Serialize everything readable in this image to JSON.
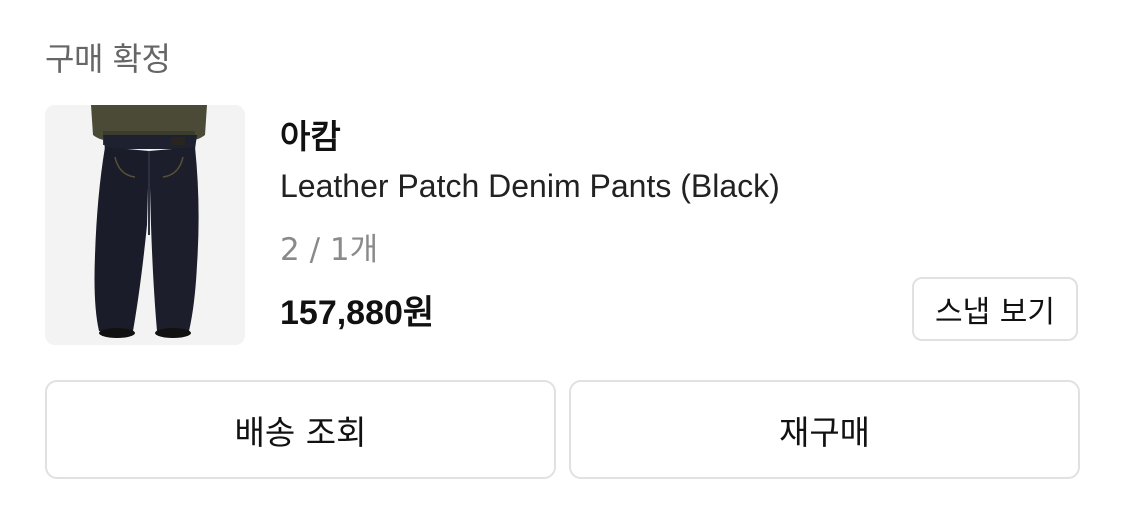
{
  "order": {
    "status_label": "구매 확정"
  },
  "product": {
    "image_alt": "black wide denim pants worn with olive jacket",
    "brand": "아캄",
    "name": "Leather Patch Denim Pants (Black)",
    "option": "2 / 1개",
    "price": "157,880원",
    "snap_button_label": "스냅 보기"
  },
  "actions": {
    "track_shipping_label": "배송 조회",
    "rebuy_label": "재구매"
  }
}
